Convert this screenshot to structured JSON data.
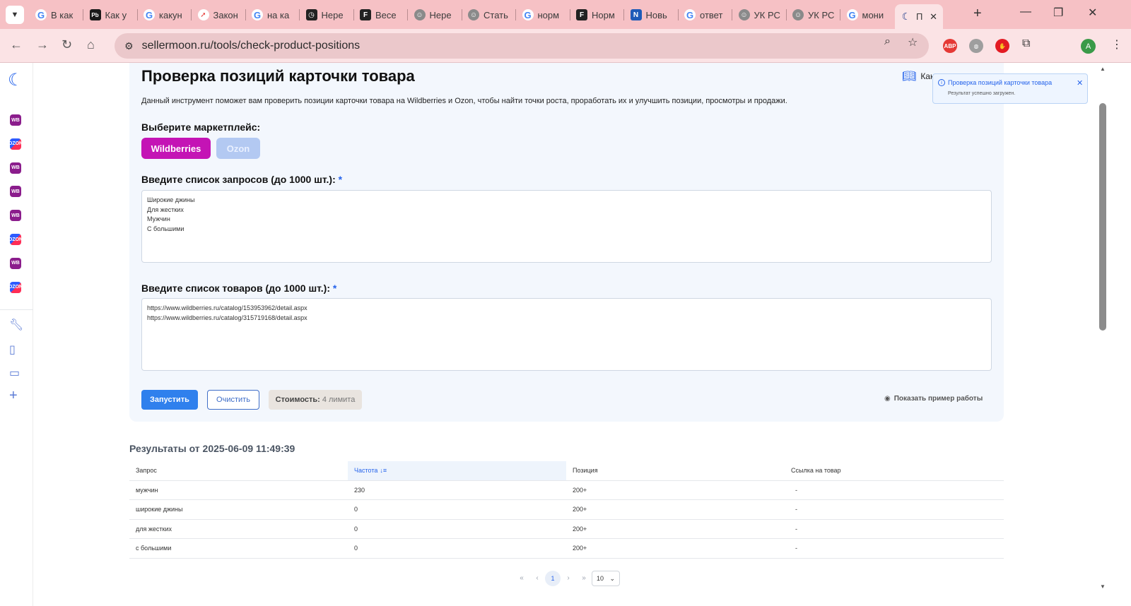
{
  "browser": {
    "tabs": [
      {
        "label": "В как",
        "favicon": "google-icon"
      },
      {
        "label": "Как у",
        "favicon": "pb-icon"
      },
      {
        "label": "какун",
        "favicon": "google-icon"
      },
      {
        "label": "Закон",
        "favicon": "red-arrow-icon"
      },
      {
        "label": "на ка",
        "favicon": "google-icon"
      },
      {
        "label": "Нере",
        "favicon": "clock-icon"
      },
      {
        "label": "Весе",
        "favicon": "f-logo-icon"
      },
      {
        "label": "Нере",
        "favicon": "profile-icon"
      },
      {
        "label": "Стать",
        "favicon": "profile-icon"
      },
      {
        "label": "норм",
        "favicon": "google-icon"
      },
      {
        "label": "Норм",
        "favicon": "f-logo-icon"
      },
      {
        "label": "Новь",
        "favicon": "blue-logo-icon"
      },
      {
        "label": "ответ",
        "favicon": "google-icon"
      },
      {
        "label": "УК РС",
        "favicon": "profile-icon"
      },
      {
        "label": "УК РС",
        "favicon": "profile-icon"
      },
      {
        "label": "мони",
        "favicon": "google-icon"
      },
      {
        "label": "П",
        "favicon": "moon-icon",
        "active": true
      }
    ],
    "url": "sellermoon.ru/tools/check-product-positions",
    "profile_initial": "A",
    "ext_abp": "ABP"
  },
  "rail": {
    "marketplaces": [
      "WB",
      "OZON",
      "WB",
      "WB",
      "WB",
      "OZON",
      "WB",
      "OZON"
    ]
  },
  "tool": {
    "title": "Проверка позиций карточки товара",
    "guide_label": "Как",
    "description": "Данный инструмент поможет вам проверить позиции карточки товара на Wildberries и Ozon, чтобы найти точки роста, проработать их и улучшить позиции, просмотры и продажи.",
    "marketplace_label": "Выберите маркетплейс:",
    "marketplaces": {
      "wildberries": "Wildberries",
      "ozon": "Ozon"
    },
    "queries_label": "Введите список запросов (до 1000 шт.):",
    "queries": [
      "Широкие джины",
      "Для жестких",
      "Мужчин",
      "С большими"
    ],
    "products_label": "Введите список товаров (до 1000 шт.):",
    "products": [
      "https://www.wildberries.ru/catalog/153953962/detail.aspx",
      "https://www.wildberries.ru/catalog/315719168/detail.aspx"
    ],
    "required_mark": "*",
    "run_label": "Запустить",
    "clear_label": "Очистить",
    "cost_label": "Стоимость:",
    "cost_value": "4 лимита",
    "example_label": "Показать пример работы"
  },
  "results": {
    "title": "Результаты от 2025-06-09 11:49:39",
    "columns": [
      "Запрос",
      "Частота",
      "Позиция",
      "Ссылка на товар"
    ],
    "rows": [
      {
        "query": "мужчин",
        "frequency": "230",
        "position": "200+",
        "link": "-"
      },
      {
        "query": "широкие джины",
        "frequency": "0",
        "position": "200+",
        "link": "-"
      },
      {
        "query": "для жестких",
        "frequency": "0",
        "position": "200+",
        "link": "-"
      },
      {
        "query": "с большими",
        "frequency": "0",
        "position": "200+",
        "link": "-"
      }
    ],
    "pagination": {
      "current_page": "1",
      "page_size": "10"
    }
  },
  "toast": {
    "title": "Проверка позиций карточки товара",
    "message": "Результат успешно загружен."
  },
  "colors": {
    "accent": "#2f80ed",
    "wildberries": "#c414b5",
    "ozon_inactive": "#b3c9f2",
    "tab_bar": "#f6c1c5"
  }
}
